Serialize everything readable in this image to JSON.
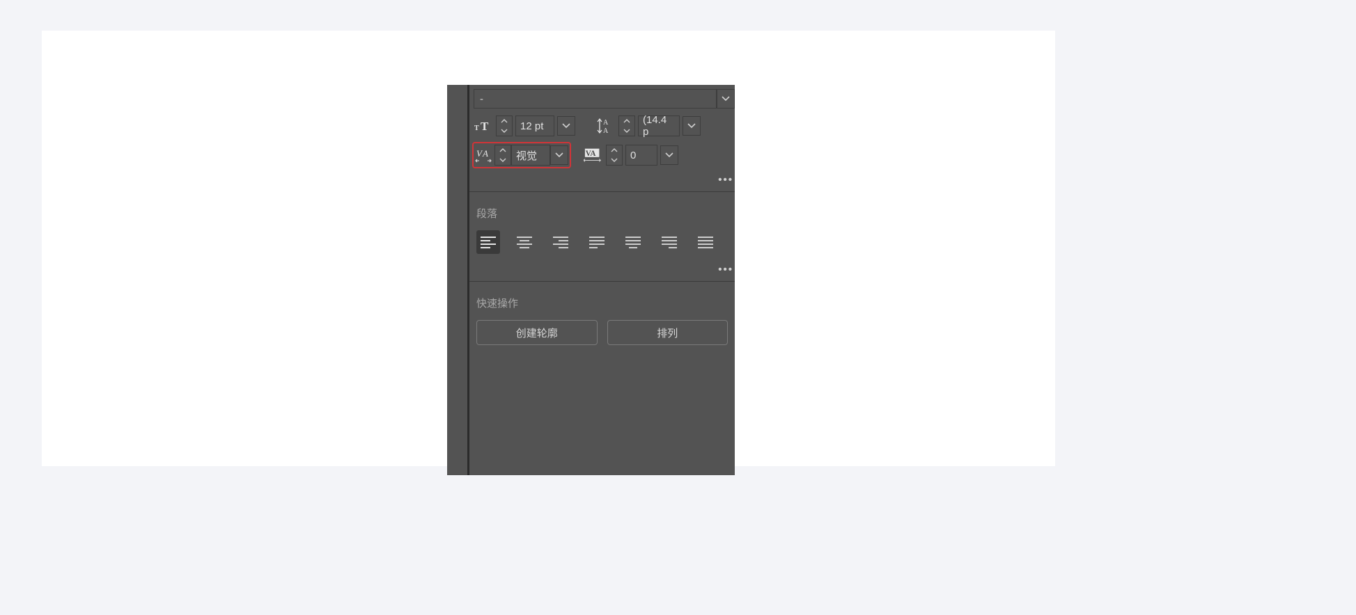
{
  "font": {
    "family": "-"
  },
  "size": {
    "value": "12 pt"
  },
  "leading": {
    "value": "(14.4 p"
  },
  "kerning": {
    "value": "视觉"
  },
  "tracking": {
    "value": "0"
  },
  "sections": {
    "paragraph": "段落",
    "quick": "快速操作"
  },
  "buttons": {
    "createOutline": "创建轮廓",
    "arrange": "排列"
  },
  "icons": {
    "fontSize": "font-size-icon",
    "leading": "leading-icon",
    "kerning": "kerning-icon",
    "tracking": "tracking-icon"
  }
}
